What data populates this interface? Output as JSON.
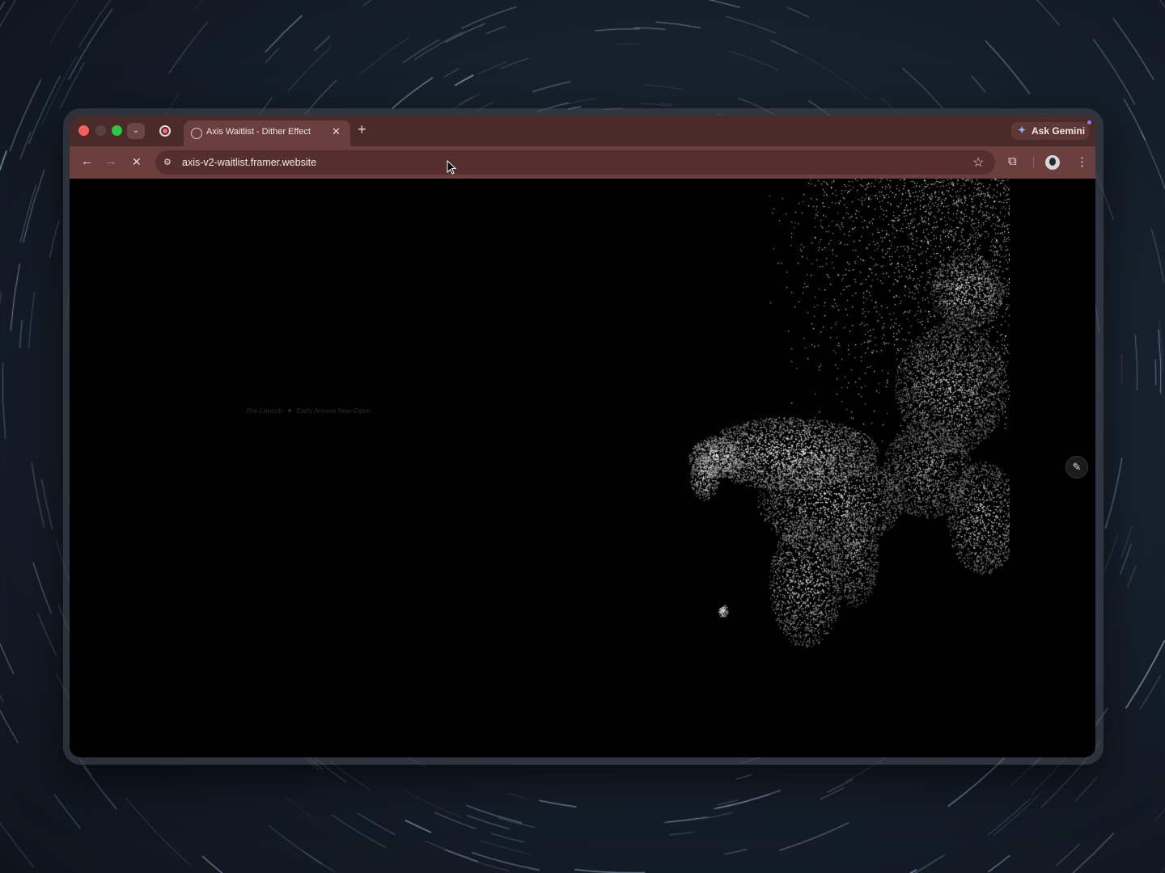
{
  "browser": {
    "tab": {
      "title": "Axis Waitlist - Dither Effect",
      "close": "✕"
    },
    "new_tab": "+",
    "ask_gemini": "Ask Gemini",
    "url": "axis-v2-waitlist.framer.website",
    "icons": {
      "back": "←",
      "forward": "→",
      "stop": "✕",
      "site_info": "⚙",
      "star": "☆",
      "extensions": "⧉",
      "menu": "⋮",
      "gemini": "✦",
      "tab_search": "⌄"
    }
  },
  "page": {
    "badge_left": "Pre-Launch",
    "badge_separator": "✦",
    "badge_right": "Early Access Now Open",
    "edit_icon": "✎"
  },
  "colors": {
    "titlebar": "#4a2b2a",
    "toolbar": "#6b3f3d",
    "page_background": "#000000"
  }
}
